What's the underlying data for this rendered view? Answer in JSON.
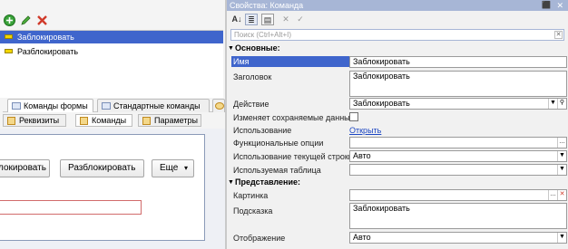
{
  "left": {
    "commands": [
      {
        "label": "Заблокировать"
      },
      {
        "label": "Разблокировать"
      }
    ],
    "tabs_top": [
      {
        "label": "Команды формы"
      },
      {
        "label": "Стандартные команды"
      }
    ],
    "tabs_bottom": [
      {
        "label": "Реквизиты"
      },
      {
        "label": "Команды"
      },
      {
        "label": "Параметры"
      }
    ],
    "preview": {
      "lock_button": "локировать",
      "unlock_button": "Разблокировать",
      "more_button": "Еще",
      "more_arrow": "▾"
    }
  },
  "right": {
    "title": "Свойства: Команда",
    "search_placeholder": "Поиск (Ctrl+Alt+I)",
    "groups": {
      "main": "Основные:",
      "view": "Представление:"
    },
    "props": {
      "name_label": "Имя",
      "name_value": "Заблокировать",
      "header_label": "Заголовок",
      "header_value": "Заблокировать",
      "action_label": "Действие",
      "action_value": "Заблокировать",
      "changes_data_label": "Изменяет сохраняемые данные",
      "usage_label": "Использование",
      "usage_link": "Открыть",
      "func_options_label": "Функциональные опции",
      "current_row_label": "Использование текущей строки",
      "current_row_value": "Авто",
      "table_label": "Используемая таблица",
      "picture_label": "Картинка",
      "tooltip_label": "Подсказка",
      "tooltip_value": "Заблокировать",
      "display_label": "Отображение",
      "display_value": "Авто"
    },
    "colors": {
      "title_bar": "#a7b6d6",
      "selection": "#3f65cc"
    }
  }
}
